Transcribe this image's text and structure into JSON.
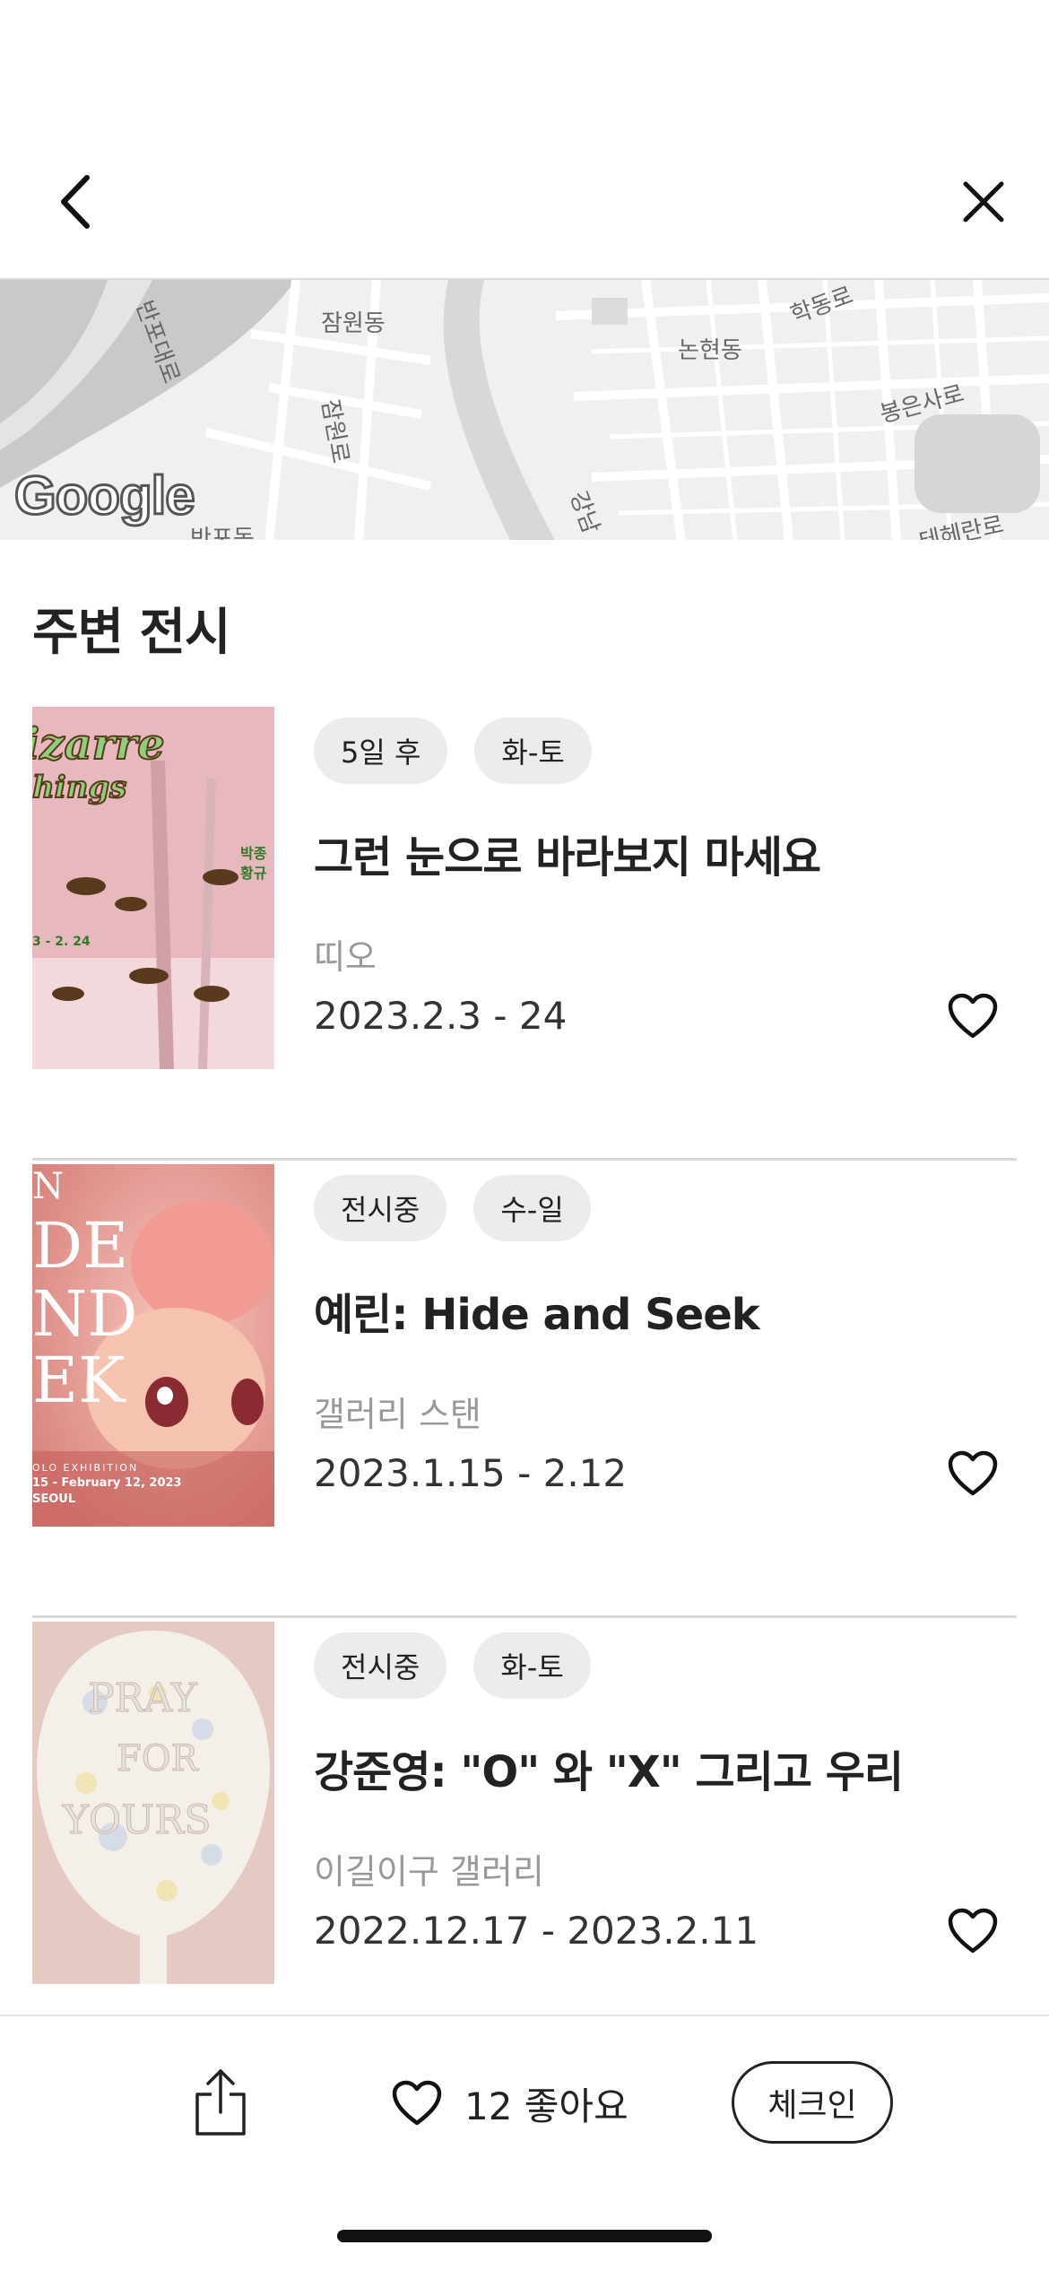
{
  "map": {
    "labels": [
      "잠원동",
      "반포대로",
      "학동로",
      "논현동",
      "봉은사로",
      "잠원로",
      "강남",
      "반포동",
      "테헤란로"
    ],
    "logo": "Google"
  },
  "section": {
    "title": "주변 전시"
  },
  "exhibitions": [
    {
      "tags": [
        "5일 후",
        "화-토"
      ],
      "title": "그런 눈으로 바라보지 마세요",
      "venue": "띠오",
      "dates": "2023.2.3 - 24",
      "poster": {
        "text": [
          "izarre",
          "hings",
          "박종",
          "황규",
          "3 - 2. 24"
        ],
        "bg": "#e7b9bf"
      }
    },
    {
      "tags": [
        "전시중",
        "수-일"
      ],
      "title": "예린: Hide and Seek",
      "venue": "갤러리 스탠",
      "dates": "2023.1.15 - 2.12",
      "poster": {
        "text": [
          "N",
          "DE",
          "ND",
          "EK",
          "OLO EXHIBITION",
          "15 - February 12, 2023",
          "SEOUL"
        ],
        "bg": "#e9a7a4"
      }
    },
    {
      "tags": [
        "전시중",
        "화-토"
      ],
      "title": "강준영: \"O\" 와 \"X\" 그리고 우리",
      "venue": "이길이구 갤러리",
      "dates": "2022.12.17 - 2023.2.11",
      "poster": {
        "text": [
          "PRAY",
          "FOR",
          "YOURS"
        ],
        "bg": "#e5c9c3"
      }
    }
  ],
  "bottom": {
    "likes": "12 좋아요",
    "checkin": "체크인"
  },
  "icons": {
    "back": "chevron-left-icon",
    "close": "close-icon",
    "like": "heart-outline-icon",
    "share": "share-icon"
  }
}
